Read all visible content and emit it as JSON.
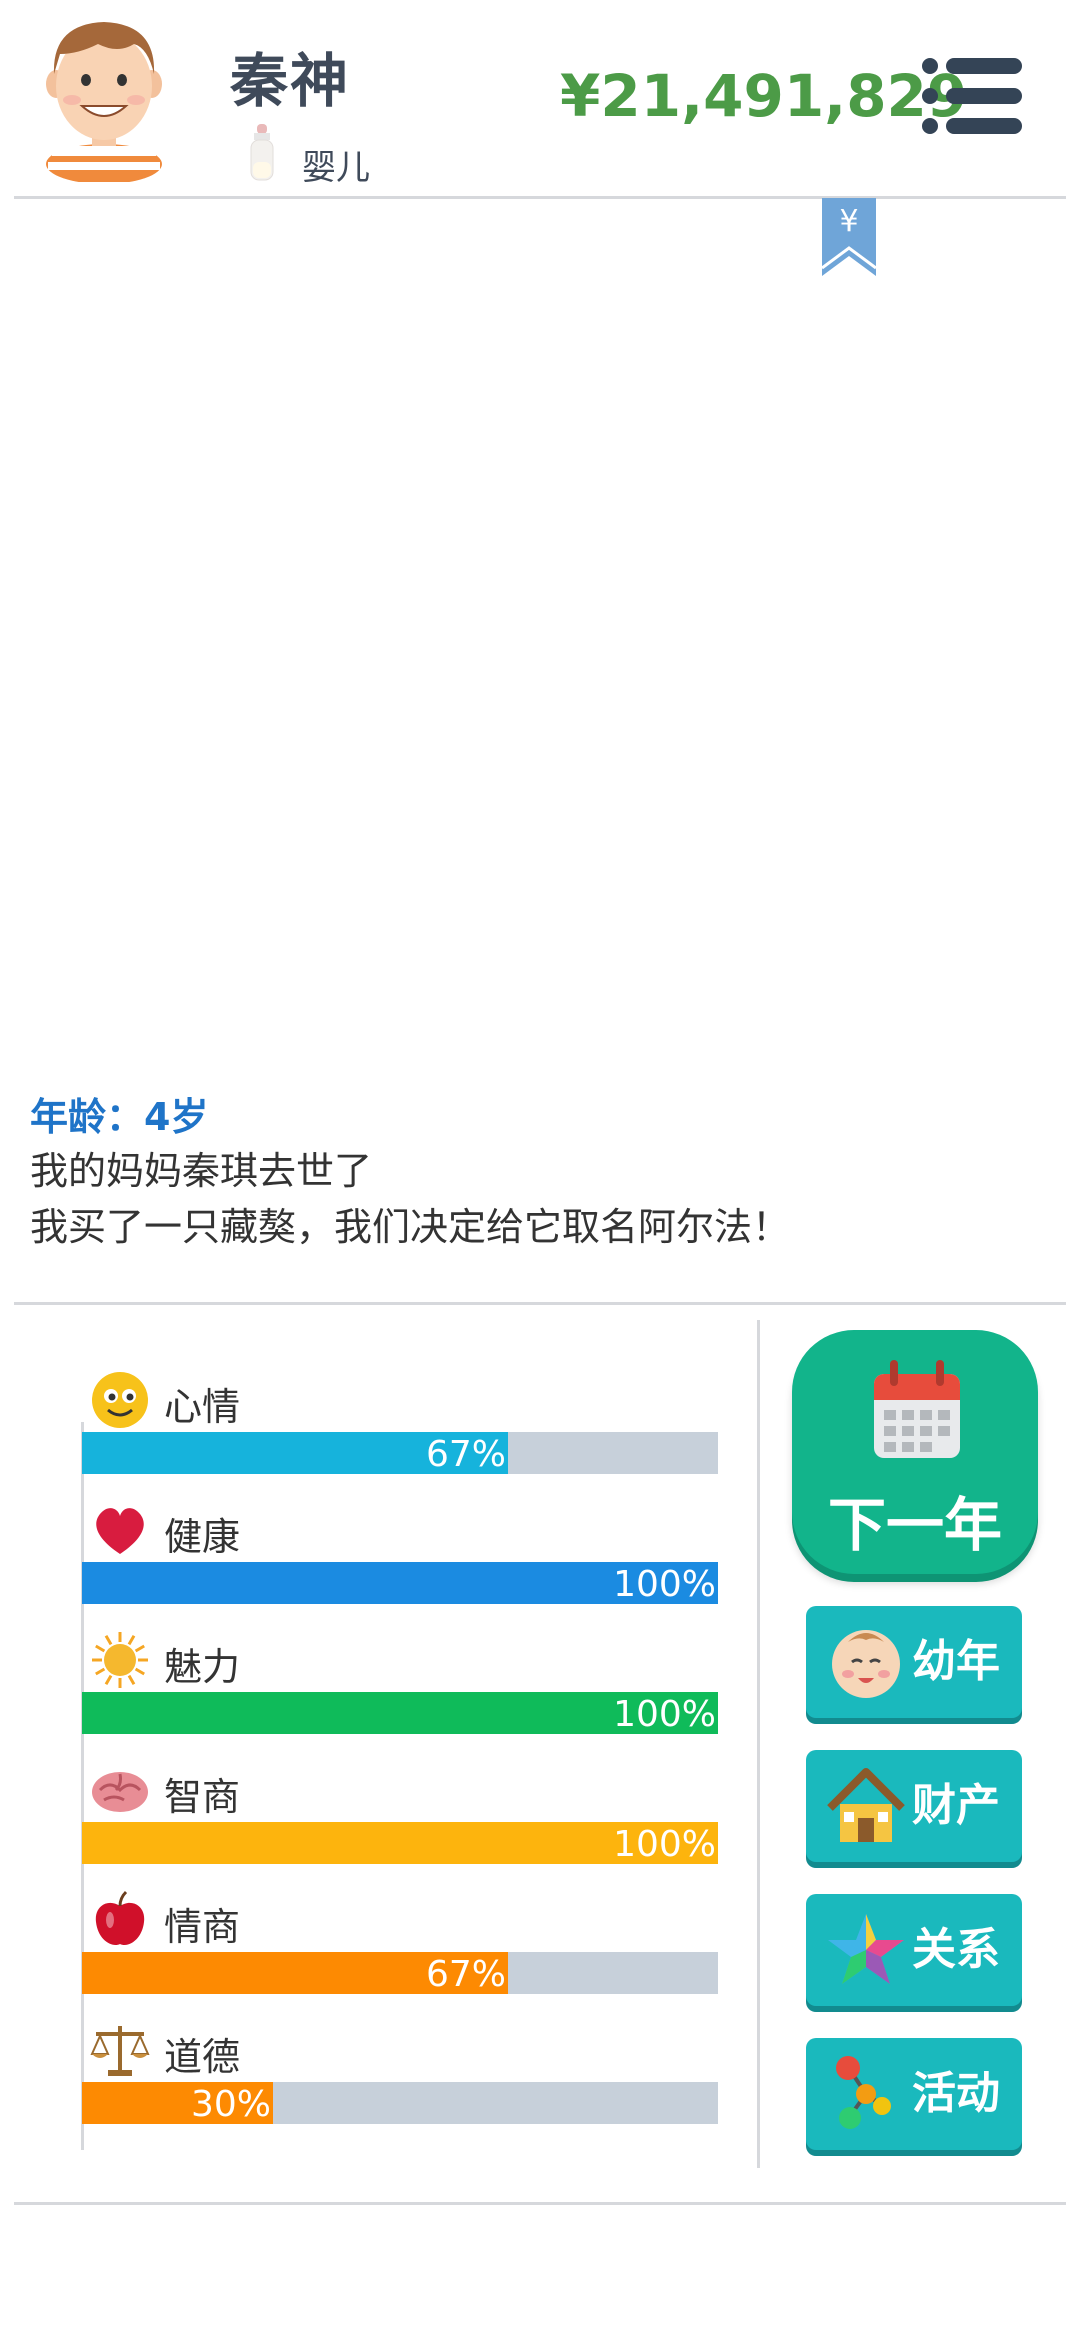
{
  "header": {
    "name": "秦神",
    "stage": "婴儿",
    "money": "¥21,491,829"
  },
  "bookmark": {
    "symbol": "¥"
  },
  "log": {
    "age": "年龄：4岁",
    "lines": [
      "我的妈妈秦琪去世了",
      "我买了一只藏獒，我们决定给它取名阿尔法！"
    ]
  },
  "stats": [
    {
      "label": "心情",
      "value": "67%",
      "fraction": 0.67,
      "color": "#16b3dc",
      "icon": "smiley-icon"
    },
    {
      "label": "健康",
      "value": "100%",
      "fraction": 1.0,
      "color": "#1b8be1",
      "icon": "heart-icon"
    },
    {
      "label": "魅力",
      "value": "100%",
      "fraction": 1.0,
      "color": "#0fbb5a",
      "icon": "sun-icon"
    },
    {
      "label": "智商",
      "value": "100%",
      "fraction": 1.0,
      "color": "#fdb40d",
      "icon": "brain-icon"
    },
    {
      "label": "情商",
      "value": "67%",
      "fraction": 0.67,
      "color": "#fd8a02",
      "icon": "apple-icon"
    },
    {
      "label": "道德",
      "value": "30%",
      "fraction": 0.3,
      "color": "#fd8a02",
      "icon": "scales-icon"
    }
  ],
  "buttons": {
    "next_year": "下一年",
    "childhood": "幼年",
    "assets": "财产",
    "relations": "关系",
    "activities": "活动"
  }
}
